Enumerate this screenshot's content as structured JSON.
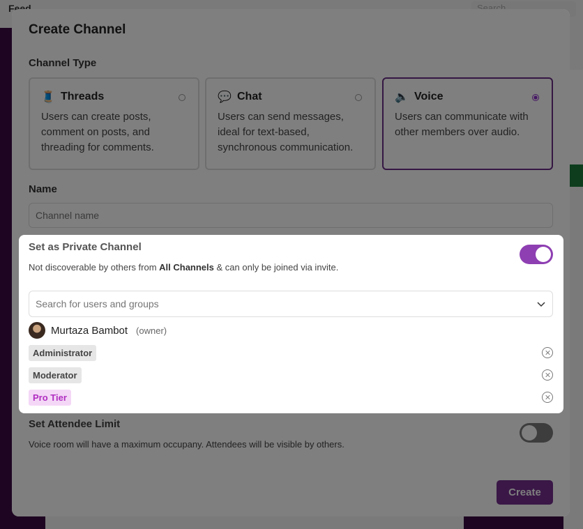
{
  "background": {
    "feed_label": "Feed",
    "search_placeholder": "Search"
  },
  "modal": {
    "title": "Create Channel",
    "channel_type_label": "Channel Type",
    "types": [
      {
        "emoji": "🧵",
        "name": "Threads",
        "desc": "Users can create posts, comment on posts, and threading for comments.",
        "selected": false
      },
      {
        "emoji": "💬",
        "name": "Chat",
        "desc": "Users can send messages, ideal for text-based, synchronous communication.",
        "selected": false
      },
      {
        "emoji": "🔈",
        "name": "Voice",
        "desc": "Users can communicate with other members over audio.",
        "selected": true
      }
    ],
    "name_label": "Name",
    "name_placeholder": "Channel name",
    "private": {
      "title": "Set as Private Channel",
      "desc_pre": "Not discoverable by others from ",
      "desc_bold": "All Channels",
      "desc_post": " & can only be joined via invite.",
      "enabled": true,
      "search_placeholder": "Search for users and groups",
      "owner_name": "Murtaza Bambot",
      "owner_tag": "(owner)",
      "roles": [
        "Administrator",
        "Moderator",
        "Pro Tier"
      ]
    },
    "attendee": {
      "title": "Set Attendee Limit",
      "desc": "Voice room will have a maximum occupany. Attendees will be visible by others.",
      "enabled": false
    },
    "create_label": "Create"
  },
  "colors": {
    "accent": "#6b2e86",
    "toggle_on": "#8e3fb2",
    "pro_tag_bg": "#f4d7f7",
    "pro_tag_text": "#b02dc0"
  }
}
